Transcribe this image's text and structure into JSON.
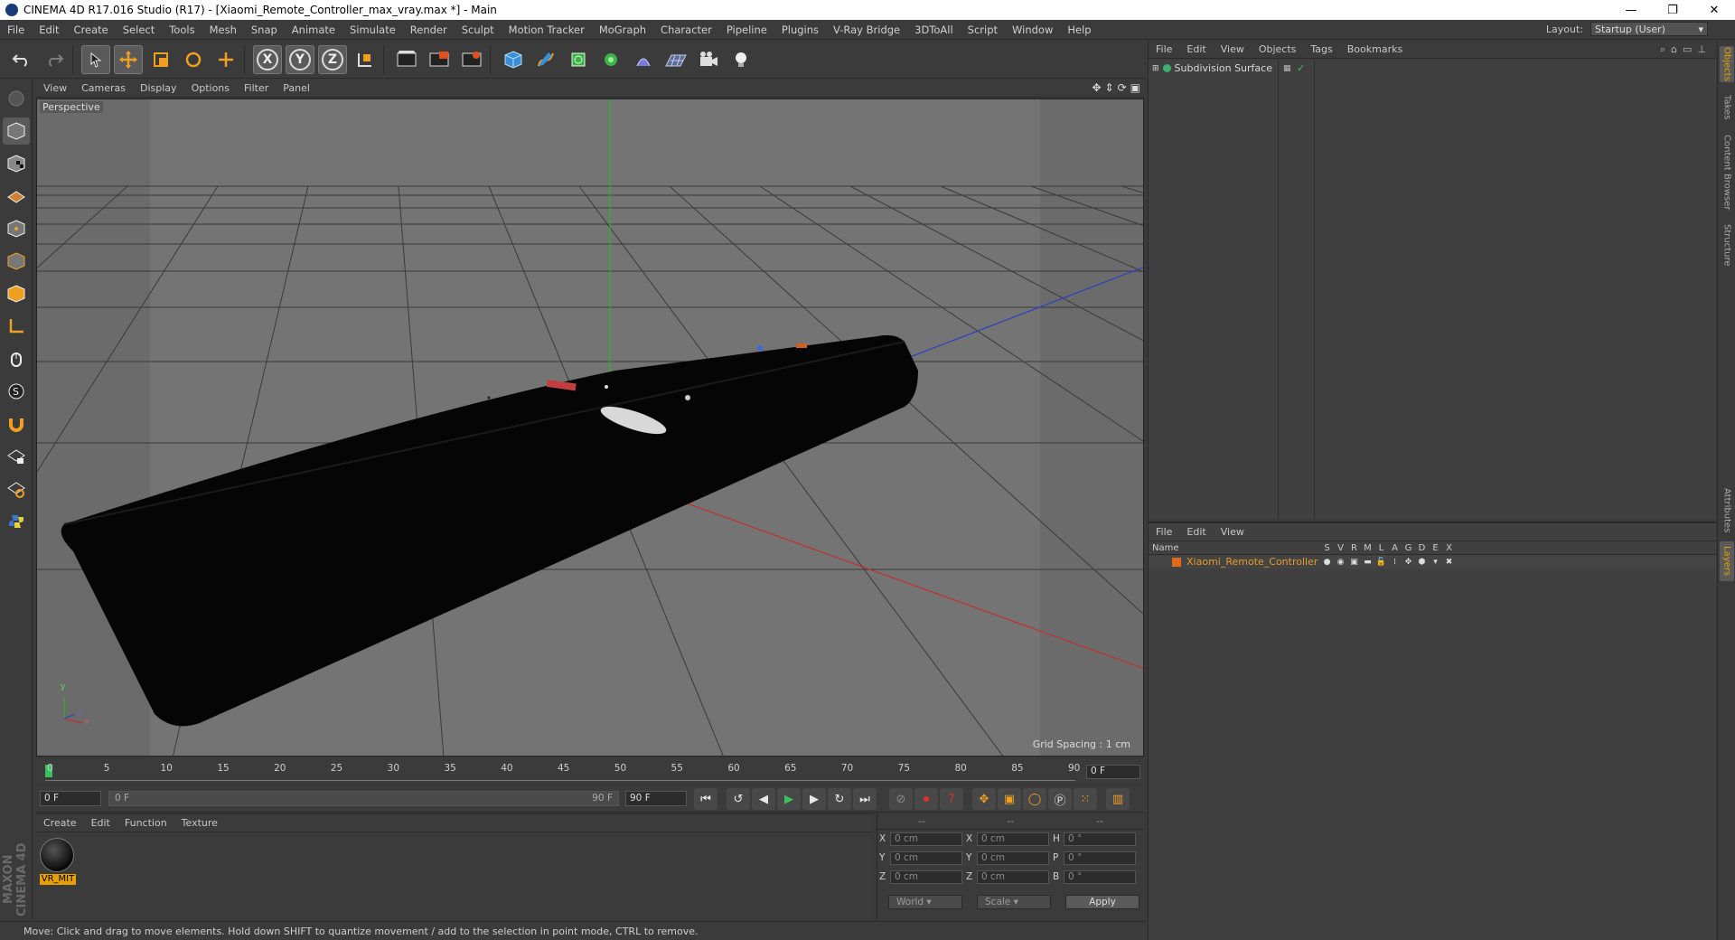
{
  "window": {
    "title": "CINEMA 4D R17.016 Studio (R17) - [Xiaomi_Remote_Controller_max_vray.max *] - Main",
    "controls": [
      "—",
      "❐",
      "✕"
    ]
  },
  "menubar": {
    "items": [
      "File",
      "Edit",
      "Create",
      "Select",
      "Tools",
      "Mesh",
      "Snap",
      "Animate",
      "Simulate",
      "Render",
      "Sculpt",
      "Motion Tracker",
      "MoGraph",
      "Character",
      "Pipeline",
      "Plugins",
      "V-Ray Bridge",
      "3DToAll",
      "Script",
      "Window",
      "Help"
    ],
    "layout_label": "Layout:",
    "layout_value": "Startup (User)"
  },
  "toolbar": {
    "axis_x": "X",
    "axis_y": "Y",
    "axis_z": "Z"
  },
  "viewport": {
    "menu": [
      "View",
      "Cameras",
      "Display",
      "Options",
      "Filter",
      "Panel"
    ],
    "label": "Perspective",
    "grid_spacing": "Grid Spacing : 1 cm",
    "axis_y": "y",
    "axis_x": "x",
    "axis_z": "z"
  },
  "timeline": {
    "ticks": [
      "0",
      "5",
      "10",
      "15",
      "20",
      "25",
      "30",
      "35",
      "40",
      "45",
      "50",
      "55",
      "60",
      "65",
      "70",
      "75",
      "80",
      "85",
      "90"
    ],
    "current_frame": "0 F",
    "start_field": "0 F",
    "slider_start": "0 F",
    "slider_end": "90 F",
    "end_field": "90 F"
  },
  "materials": {
    "menu": [
      "Create",
      "Edit",
      "Function",
      "Texture"
    ],
    "items": [
      {
        "name": "VR_MIT"
      }
    ]
  },
  "coordinates": {
    "headers": [
      "--",
      "--",
      "--"
    ],
    "rows": [
      {
        "l1": "X",
        "v1": "0 cm",
        "l2": "X",
        "v2": "0 cm",
        "l3": "H",
        "v3": "0 °"
      },
      {
        "l1": "Y",
        "v1": "0 cm",
        "l2": "Y",
        "v2": "0 cm",
        "l3": "P",
        "v3": "0 °"
      },
      {
        "l1": "Z",
        "v1": "0 cm",
        "l2": "Z",
        "v2": "0 cm",
        "l3": "B",
        "v3": "0 °"
      }
    ],
    "world_dropdown": "World",
    "scale_dropdown": "Scale",
    "apply_label": "Apply"
  },
  "status": {
    "text": "Move: Click and drag to move elements. Hold down SHIFT to quantize movement / add to the selection in point mode, CTRL to remove."
  },
  "objects_panel": {
    "menu": [
      "File",
      "Edit",
      "View",
      "Objects",
      "Tags",
      "Bookmarks"
    ],
    "objects": [
      {
        "name": "Subdivision Surface"
      }
    ]
  },
  "layers_panel": {
    "menu": [
      "File",
      "Edit",
      "View"
    ],
    "name_header": "Name",
    "columns": [
      "S",
      "V",
      "R",
      "M",
      "L",
      "A",
      "G",
      "D",
      "E",
      "X"
    ],
    "layers": [
      {
        "name": "Xiaomi_Remote_Controller",
        "color": "#e06a16"
      }
    ]
  },
  "side_tabs": {
    "top": [
      "Objects",
      "Takes",
      "Content Browser",
      "Structure"
    ],
    "bottom": [
      "Attributes",
      "Layers"
    ]
  },
  "branding": {
    "vertical_logo": "MAXON CINEMA 4D"
  },
  "colors": {
    "accent": "#e6a000",
    "x_axis": "#c03030",
    "y_axis": "#30b030",
    "z_axis": "#3040c0"
  }
}
